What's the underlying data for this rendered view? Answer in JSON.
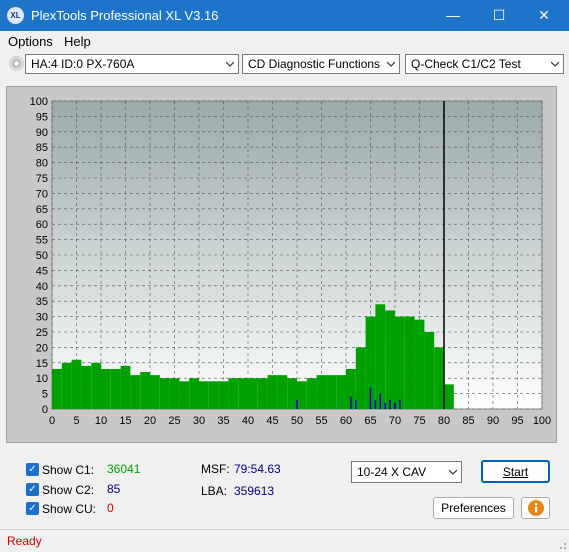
{
  "window": {
    "title": "PlexTools Professional XL V3.16",
    "icon_text": "XL"
  },
  "menu": {
    "options": "Options",
    "help": "Help"
  },
  "toolbar": {
    "drive": "HA:4 ID:0  PX-760A",
    "function": "CD Diagnostic Functions",
    "test": "Q-Check C1/C2 Test"
  },
  "chart_data": {
    "type": "bar",
    "xlim": [
      0,
      100
    ],
    "ylim": [
      0,
      100
    ],
    "x_ticks": [
      "0",
      "5",
      "10",
      "15",
      "20",
      "25",
      "30",
      "35",
      "40",
      "45",
      "50",
      "55",
      "60",
      "65",
      "70",
      "75",
      "80",
      "85",
      "90",
      "95",
      "100"
    ],
    "y_ticks": [
      "0",
      "5",
      "10",
      "15",
      "20",
      "25",
      "30",
      "35",
      "40",
      "45",
      "50",
      "55",
      "60",
      "65",
      "70",
      "75",
      "80",
      "85",
      "90",
      "95",
      "100"
    ],
    "grid": true,
    "end_marker_x": 80,
    "series": [
      {
        "name": "C1",
        "color": "#00a000",
        "x": [
          0,
          2,
          4,
          6,
          8,
          10,
          12,
          14,
          16,
          18,
          20,
          22,
          24,
          26,
          28,
          30,
          32,
          34,
          36,
          38,
          40,
          42,
          44,
          46,
          48,
          50,
          52,
          54,
          56,
          58,
          60,
          62,
          64,
          66,
          68,
          70,
          72,
          74,
          76,
          78,
          80
        ],
        "values": [
          13,
          15,
          16,
          14,
          15,
          13,
          13,
          14,
          11,
          12,
          11,
          10,
          10,
          9,
          10,
          9,
          9,
          9,
          10,
          10,
          10,
          10,
          11,
          11,
          10,
          9,
          10,
          11,
          11,
          11,
          13,
          20,
          30,
          34,
          32,
          30,
          30,
          29,
          25,
          20,
          8
        ]
      },
      {
        "name": "C2",
        "color": "#0000c8",
        "x": [
          50,
          61,
          62,
          65,
          66,
          67,
          68,
          69,
          70,
          71
        ],
        "values": [
          3,
          4,
          3,
          7,
          3,
          5,
          2,
          3,
          2,
          3
        ]
      }
    ]
  },
  "stats": {
    "show_c1_label": "Show C1:",
    "c1_value": "36041",
    "c1_color": "#00a000",
    "show_c2_label": "Show C2:",
    "c2_value": "85",
    "c2_color": "#00008b",
    "show_cu_label": "Show CU:",
    "cu_value": "0",
    "cu_color": "#d40000",
    "msf_label": "MSF:",
    "msf_value": "79:54.63",
    "lba_label": "LBA:",
    "lba_value": "359613"
  },
  "controls": {
    "speed": "10-24 X CAV",
    "start": "Start",
    "preferences": "Preferences"
  },
  "status": {
    "text": "Ready"
  }
}
